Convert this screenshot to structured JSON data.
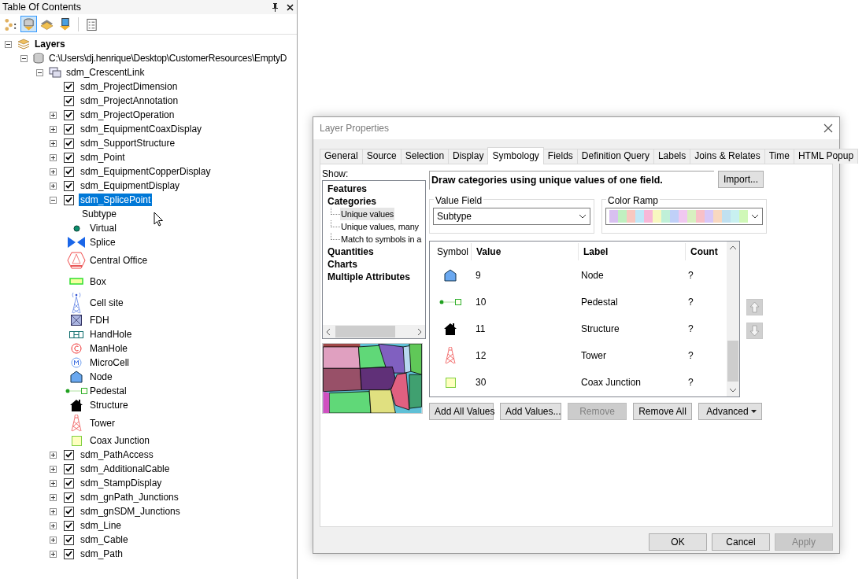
{
  "toc": {
    "title": "Table Of Contents",
    "toolbar": [
      {
        "kind": "order",
        "selected": false
      },
      {
        "kind": "source",
        "selected": true
      },
      {
        "kind": "visibility",
        "selected": false
      },
      {
        "kind": "selection",
        "selected": false
      },
      {
        "kind": "options",
        "selected": false
      }
    ],
    "tree": [
      {
        "kind": "frame",
        "label": "Layers",
        "expandable": true,
        "expanded": true,
        "children": [
          {
            "kind": "database",
            "label": "C:\\Users\\dj.henrique\\Desktop\\CustomerResources\\EmptyD",
            "expandable": true,
            "expanded": true,
            "children": [
              {
                "kind": "group",
                "label": "sdm_CrescentLink",
                "expandable": true,
                "expanded": true,
                "children": [
                  {
                    "kind": "layer",
                    "label": "sdm_ProjectDimension",
                    "checked": true,
                    "selected": false
                  },
                  {
                    "kind": "layer",
                    "label": "sdm_ProjectAnnotation",
                    "checked": true,
                    "selected": false
                  },
                  {
                    "kind": "layer",
                    "label": "sdm_ProjectOperation",
                    "expandable": true,
                    "expanded": false,
                    "checked": true,
                    "selected": false
                  },
                  {
                    "kind": "layer",
                    "label": "sdm_EquipmentCoaxDisplay",
                    "expandable": true,
                    "expanded": false,
                    "checked": true,
                    "selected": false
                  },
                  {
                    "kind": "layer",
                    "label": "sdm_SupportStructure",
                    "expandable": true,
                    "expanded": false,
                    "checked": true,
                    "selected": false
                  },
                  {
                    "kind": "layer",
                    "label": "sdm_Point",
                    "expandable": true,
                    "expanded": false,
                    "checked": true,
                    "selected": false
                  },
                  {
                    "kind": "layer",
                    "label": "sdm_EquipmentCopperDisplay",
                    "expandable": true,
                    "expanded": false,
                    "checked": true,
                    "selected": false
                  },
                  {
                    "kind": "layer",
                    "label": "sdm_EquipmentDisplay",
                    "expandable": true,
                    "expanded": false,
                    "checked": true,
                    "selected": false
                  },
                  {
                    "kind": "layer",
                    "label": "sdm_SplicePoint",
                    "expandable": true,
                    "expanded": true,
                    "checked": true,
                    "selected": true,
                    "legend": {
                      "heading": "Subtype",
                      "classes": [
                        {
                          "kind": "dot",
                          "label": "Virtual"
                        },
                        {
                          "kind": "bowtie",
                          "label": "Splice"
                        },
                        {
                          "kind": "hexagon",
                          "label": "Central Office"
                        },
                        {
                          "kind": "box",
                          "label": "Box"
                        },
                        {
                          "kind": "cellsite",
                          "label": "Cell site"
                        },
                        {
                          "kind": "fdh",
                          "label": "FDH"
                        },
                        {
                          "kind": "handhole",
                          "label": "HandHole"
                        },
                        {
                          "kind": "manhole",
                          "label": "ManHole"
                        },
                        {
                          "kind": "microcell",
                          "label": "MicroCell"
                        },
                        {
                          "kind": "node",
                          "label": "Node"
                        },
                        {
                          "kind": "pedestal",
                          "label": "Pedestal"
                        },
                        {
                          "kind": "structure",
                          "label": "Structure"
                        },
                        {
                          "kind": "tower",
                          "label": "Tower"
                        },
                        {
                          "kind": "coax",
                          "label": "Coax Junction"
                        }
                      ]
                    }
                  },
                  {
                    "kind": "layer",
                    "label": "sdm_PathAccess",
                    "expandable": true,
                    "expanded": false,
                    "checked": true,
                    "selected": false
                  },
                  {
                    "kind": "layer",
                    "label": "sdm_AdditionalCable",
                    "expandable": true,
                    "expanded": false,
                    "checked": true,
                    "selected": false
                  },
                  {
                    "kind": "layer",
                    "label": "sdm_StampDisplay",
                    "expandable": true,
                    "expanded": false,
                    "checked": true,
                    "selected": false
                  },
                  {
                    "kind": "layer",
                    "label": "sdm_gnPath_Junctions",
                    "expandable": true,
                    "expanded": false,
                    "checked": true,
                    "selected": false
                  },
                  {
                    "kind": "layer",
                    "label": "sdm_gnSDM_Junctions",
                    "expandable": true,
                    "expanded": false,
                    "checked": true,
                    "selected": false
                  },
                  {
                    "kind": "layer",
                    "label": "sdm_Line",
                    "expandable": true,
                    "expanded": false,
                    "checked": true,
                    "selected": false
                  },
                  {
                    "kind": "layer",
                    "label": "sdm_Cable",
                    "expandable": true,
                    "expanded": false,
                    "checked": true,
                    "selected": false
                  },
                  {
                    "kind": "layer",
                    "label": "sdm_Path",
                    "expandable": true,
                    "expanded": false,
                    "checked": true,
                    "selected": false
                  }
                ]
              }
            ]
          }
        ]
      }
    ]
  },
  "dialog": {
    "title": "Layer Properties",
    "tabs": [
      {
        "label": "General",
        "selected": false
      },
      {
        "label": "Source",
        "selected": false
      },
      {
        "label": "Selection",
        "selected": false
      },
      {
        "label": "Display",
        "selected": false
      },
      {
        "label": "Symbology",
        "selected": true
      },
      {
        "label": "Fields",
        "selected": false
      },
      {
        "label": "Definition Query",
        "selected": false
      },
      {
        "label": "Labels",
        "selected": false
      },
      {
        "label": "Joins & Relates",
        "selected": false
      },
      {
        "label": "Time",
        "selected": false
      },
      {
        "label": "HTML Popup",
        "selected": false
      }
    ],
    "show_label": "Show:",
    "show_tree": [
      {
        "label": "Features",
        "selected": false
      },
      {
        "label": "Categories",
        "selected": false,
        "children": [
          {
            "label": "Unique values",
            "selected": true
          },
          {
            "label": "Unique values, many",
            "selected": false
          },
          {
            "label": "Match to symbols in a",
            "selected": false
          }
        ]
      },
      {
        "label": "Quantities",
        "selected": false
      },
      {
        "label": "Charts",
        "selected": false
      },
      {
        "label": "Multiple Attributes",
        "selected": false
      }
    ],
    "description": "Draw categories using unique values of one field.",
    "import_button": "Import...",
    "value_field": {
      "legend": "Value Field",
      "value": "Subtype"
    },
    "color_ramp": {
      "legend": "Color Ramp"
    },
    "table": {
      "columns": [
        "Symbol",
        "Value",
        "Label",
        "Count"
      ],
      "rows": [
        {
          "kind": "node",
          "value": "9",
          "label": "Node",
          "count": "?"
        },
        {
          "kind": "pedestal",
          "value": "10",
          "label": "Pedestal",
          "count": "?"
        },
        {
          "kind": "structure",
          "value": "11",
          "label": "Structure",
          "count": "?"
        },
        {
          "kind": "tower",
          "value": "12",
          "label": "Tower",
          "count": "?"
        },
        {
          "kind": "coax",
          "value": "30",
          "label": "Coax Junction",
          "count": "?"
        }
      ]
    },
    "list_buttons": [
      {
        "label": "Add All Values",
        "kind": "plain",
        "disabled": false
      },
      {
        "label": "Add Values...",
        "kind": "plain",
        "disabled": false
      },
      {
        "label": "Remove",
        "kind": "plain",
        "disabled": true
      },
      {
        "label": "Remove All",
        "kind": "plain",
        "disabled": false
      },
      {
        "label": "Advanced",
        "kind": "dropdown",
        "disabled": false
      }
    ],
    "footer_buttons": [
      {
        "label": "OK",
        "disabled": false
      },
      {
        "label": "Cancel",
        "disabled": false
      },
      {
        "label": "Apply",
        "disabled": true
      }
    ]
  }
}
